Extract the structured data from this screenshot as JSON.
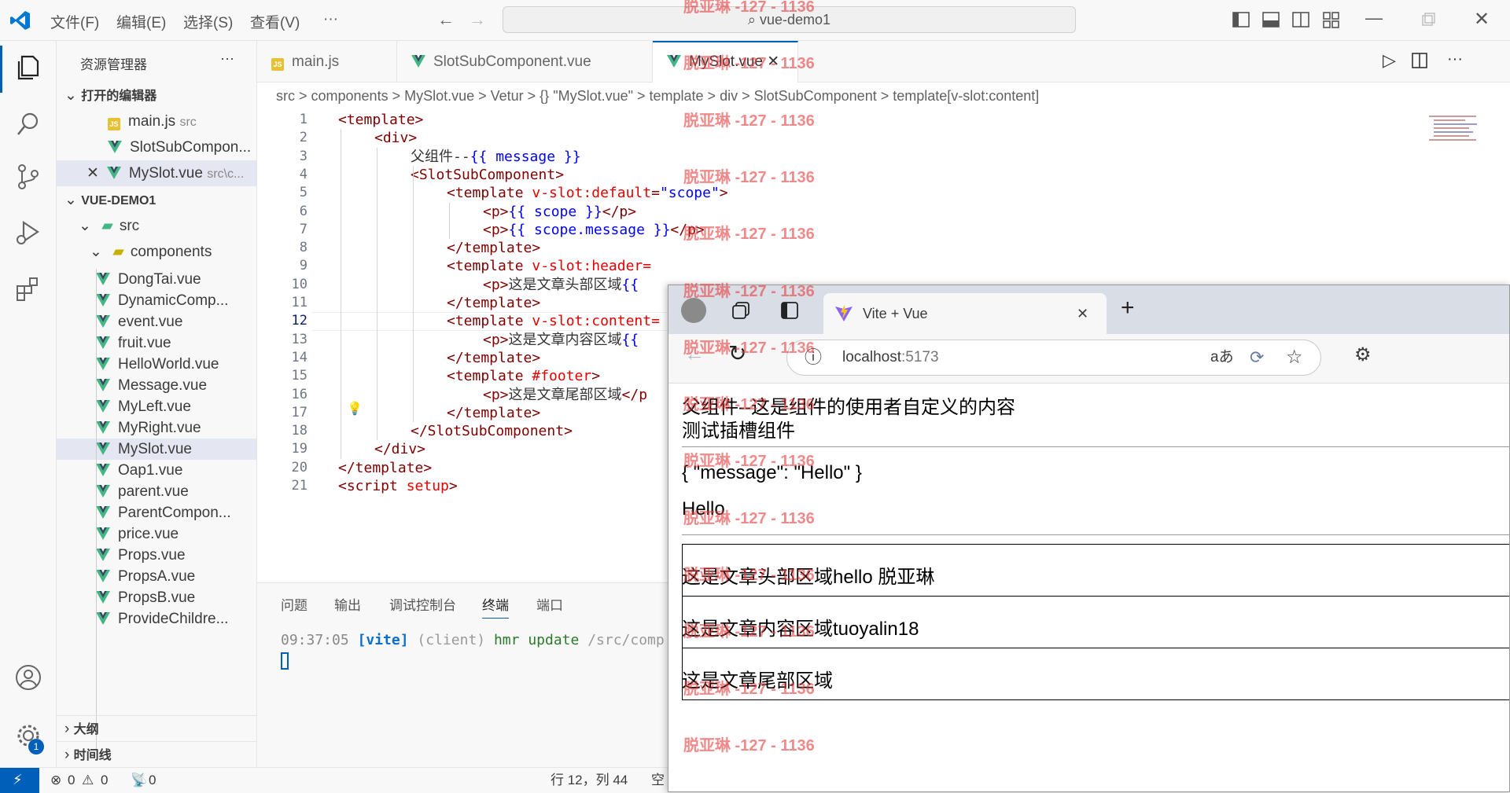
{
  "titlebar": {
    "menus": [
      "文件(F)",
      "编辑(E)",
      "选择(S)",
      "查看(V)",
      "···"
    ],
    "search": "vue-demo1"
  },
  "tabs": [
    {
      "label": "main.js",
      "icon": "js-icon"
    },
    {
      "label": "SlotSubComponent.vue",
      "icon": "vue-icon"
    },
    {
      "label": "MySlot.vue",
      "icon": "vue-icon",
      "active": true
    }
  ],
  "breadcrumb": "src > components > MySlot.vue > Vetur > {} \"MySlot.vue\" > template > div > SlotSubComponent > template[v-slot:content]",
  "sidebar": {
    "title": "资源管理器",
    "more": "···",
    "open_editors_header": "打开的编辑器",
    "open_editors": [
      {
        "name": "main.js",
        "path": "src"
      },
      {
        "name": "SlotSubCompon...",
        "path": ""
      },
      {
        "name": "MySlot.vue",
        "path": "src\\c..."
      }
    ],
    "project_header": "VUE-DEMO1",
    "src_label": "src",
    "components_label": "components",
    "files": [
      "DongTai.vue",
      "DynamicComp...",
      "event.vue",
      "fruit.vue",
      "HelloWorld.vue",
      "Message.vue",
      "MyLeft.vue",
      "MyRight.vue",
      "MySlot.vue",
      "Oap1.vue",
      "parent.vue",
      "ParentCompon...",
      "price.vue",
      "Props.vue",
      "PropsA.vue",
      "PropsB.vue",
      "ProvideChildre..."
    ],
    "outline": "大纲",
    "timeline": "时间线"
  },
  "editor": {
    "current_line": 12,
    "lines": [
      {
        "n": "1",
        "indent": 0,
        "html": "<template>"
      },
      {
        "n": "2",
        "indent": 1,
        "html": "<div>"
      },
      {
        "n": "3",
        "indent": 2,
        "text": "父组件--",
        "mustache": "{{ message }}"
      },
      {
        "n": "4",
        "indent": 2,
        "html": "<SlotSubComponent>"
      },
      {
        "n": "5",
        "indent": 3,
        "tpl": "<template ",
        "attr": "v-slot:default",
        "eq": "=",
        "val": "\"scope\"",
        "end": ">"
      },
      {
        "n": "6",
        "indent": 4,
        "html": "<p>",
        "mustache": "{{ scope }}",
        "html2": "</p>"
      },
      {
        "n": "7",
        "indent": 4,
        "html": "<p>",
        "mustache": "{{ scope.message }}",
        "html2": "</p>"
      },
      {
        "n": "8",
        "indent": 3,
        "html": "</template>"
      },
      {
        "n": "9",
        "indent": 3,
        "tpl": "<template ",
        "attr": "v-slot:header=",
        "eq": "",
        "val": "",
        "end": ""
      },
      {
        "n": "10",
        "indent": 4,
        "html": "<p>",
        "text": "这是文章头部区域",
        "mustache": "{{"
      },
      {
        "n": "11",
        "indent": 3,
        "html": "</template>"
      },
      {
        "n": "12",
        "indent": 3,
        "tpl": "<template ",
        "attr": "v-slot:content=",
        "eq": "",
        "val": "",
        "end": ""
      },
      {
        "n": "13",
        "indent": 4,
        "html": "<p>",
        "text": "这是文章内容区域",
        "mustache": "{{"
      },
      {
        "n": "14",
        "indent": 3,
        "html": "</template>"
      },
      {
        "n": "15",
        "indent": 3,
        "tpl": "<template ",
        "attr": "#footer",
        "eq": "",
        "val": "",
        "end": ">"
      },
      {
        "n": "16",
        "indent": 4,
        "html": "<p>",
        "text": "这是文章尾部区域",
        "html2": "</p"
      },
      {
        "n": "17",
        "indent": 3,
        "html": "</template>"
      },
      {
        "n": "18",
        "indent": 2,
        "html": "</SlotSubComponent>"
      },
      {
        "n": "19",
        "indent": 1,
        "html": "</div>"
      },
      {
        "n": "20",
        "indent": 0,
        "html": "</template>"
      },
      {
        "n": "21",
        "indent": 0,
        "tpl": "<script ",
        "attr": "setup",
        "eq": "",
        "val": "",
        "end": ">"
      }
    ]
  },
  "panel": {
    "tabs": [
      "问题",
      "输出",
      "调试控制台",
      "终端",
      "端口"
    ],
    "active_tab": "终端",
    "terminal": {
      "time": "09:37:05",
      "tag": "[vite]",
      "client": "(client)",
      "msg": "hmr update",
      "path": "/src/comp"
    }
  },
  "status": {
    "errors": "0",
    "warnings": "0",
    "ports": "0",
    "position": "行 12，列 44",
    "spaces": "空"
  },
  "browser": {
    "tab_title": "Vite + Vue",
    "url_host": "localhost",
    "url_port": ":5173",
    "content": {
      "line1": "父组件--这是组件的使用者自定义的内容",
      "line2": "测试插槽组件",
      "line3": "{ \"message\": \"Hello\" }",
      "line4": "Hello",
      "header": "这是文章头部区域hello 脱亚琳",
      "content": "这是文章内容区域tuoyalin18",
      "footer": "这是文章尾部区域"
    }
  },
  "watermark": "脱亚琳 -127 - 1136",
  "colors": {
    "accent": "#005fb8",
    "vue_green": "#41b883"
  }
}
